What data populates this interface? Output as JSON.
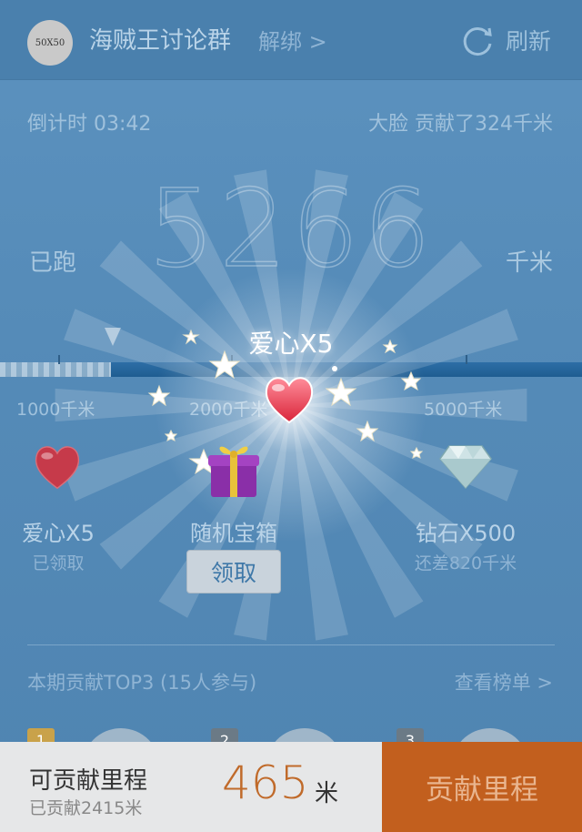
{
  "header": {
    "avatar_text": "50X50",
    "group_name": "海贼王讨论群",
    "unbind_label": "解绑 >",
    "refresh_label": "刷新"
  },
  "status": {
    "countdown": "倒计时 03:42",
    "contribution_note": "大脸 贡献了324千米",
    "distance": "5266",
    "ran_label": "已跑",
    "unit_label": "千米"
  },
  "progress": {
    "fill_fraction": 0.19,
    "milestones": [
      "1000千米",
      "2000千米",
      "5000千米"
    ]
  },
  "reward_popup": "爱心X5",
  "rewards": [
    {
      "name": "爱心X5",
      "status": "已领取",
      "icon": "heart-icon"
    },
    {
      "name": "随机宝箱",
      "action": "领取",
      "icon": "gift-box-icon"
    },
    {
      "name": "钻石X500",
      "status": "还差820千米",
      "icon": "diamond-icon"
    }
  ],
  "top3": {
    "title": "本期贡献TOP3 (15人参与)",
    "view_label": "查看榜单 >",
    "ranks": [
      "1",
      "2",
      "3"
    ]
  },
  "bottom": {
    "title": "可贡献里程",
    "subtitle": "已贡献2415米",
    "value": "465",
    "unit": "米",
    "button_label": "贡献里程"
  },
  "colors": {
    "background": "#558bb8",
    "accent_orange": "#c25f1e",
    "value_orange": "#c06a2a",
    "rank1_badge": "#c9a24a",
    "rank_badge": "#6b7a86"
  }
}
